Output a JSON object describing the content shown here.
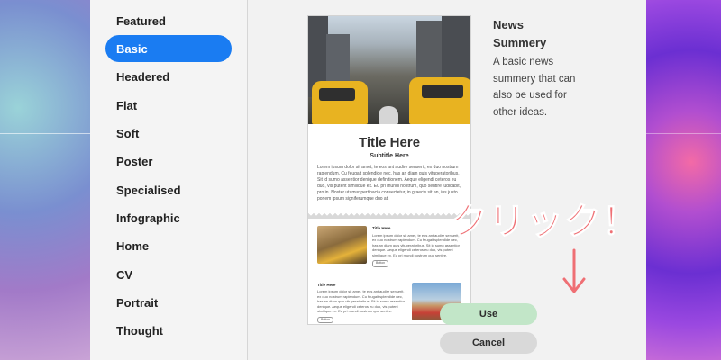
{
  "sidebar": {
    "items": [
      {
        "label": "Featured",
        "active": false
      },
      {
        "label": "Basic",
        "active": true
      },
      {
        "label": "Headered",
        "active": false
      },
      {
        "label": "Flat",
        "active": false
      },
      {
        "label": "Soft",
        "active": false
      },
      {
        "label": "Poster",
        "active": false
      },
      {
        "label": "Specialised",
        "active": false
      },
      {
        "label": "Infographic",
        "active": false
      },
      {
        "label": "Home",
        "active": false
      },
      {
        "label": "CV",
        "active": false
      },
      {
        "label": "Portrait",
        "active": false
      },
      {
        "label": "Thought",
        "active": false
      }
    ]
  },
  "preview": {
    "title": "Title Here",
    "subtitle": "Subtitle Here",
    "body": "Lorem ipsum dolor sit amet, te eos ant audire senserit, ex duo nostrum rapiendum. Cu feugait splendide nec, has an diam quis vituperatoribus. Sit id sumo assentior denique definitionem. Aeque eligendi ceteros eu duo, vis putent similique ex. Eu pri mundi nostrum, quo sentire iudicabit, pro in. Noster utamur pertinacia consectetur, in graecis sit an, ius justo ponem ipsum signiferumque duo at.",
    "cards": [
      {
        "title": "Title Here",
        "text": "Lorem ipsum dolor sit amet, te eos ant audire senserit, ex duo nostrum rapiendum. Cu feugait splendide nec, has an diam quis vituperatoribus. Sit id sumo assentior denique. Aeque eligendi ceteros eu duo, vis putent similique ex. Eu pri mundi nostrum quo sentire.",
        "button": "Button"
      },
      {
        "title": "Title Here",
        "text": "Lorem ipsum dolor sit amet, te eos ant audire senserit, ex duo nostrum rapiendum. Cu feugait splendide nec, has an diam quis vituperatoribus. Sit id sumo assentior denique. Aeque eligendi ceteros eu duo, vis putent similique ex. Eu pri mundi nostrum quo sentire.",
        "button": "Button"
      }
    ]
  },
  "info": {
    "title": "News Summery",
    "description": "A basic news summery that can also be used for other ideas."
  },
  "buttons": {
    "use": "Use",
    "cancel": "Cancel"
  },
  "annotation": {
    "text": "クリック！",
    "color": "#ef6f74"
  },
  "colors": {
    "accent": "#1a7cf2",
    "use_button": "#c2e6c8",
    "cancel_button": "#d9d9d9"
  }
}
